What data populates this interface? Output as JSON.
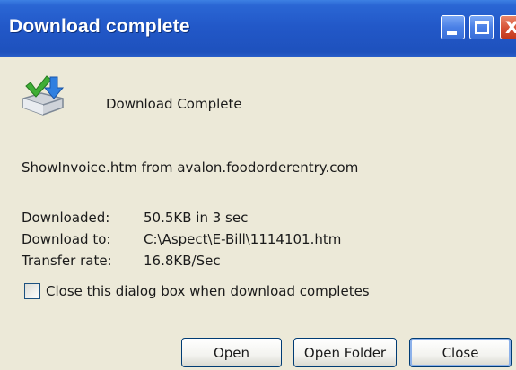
{
  "window": {
    "title": "Download complete",
    "controls": {
      "minimize": "minimize",
      "maximize": "maximize",
      "close": "close"
    },
    "close_glyph": "X"
  },
  "header": {
    "icon": "download-complete-icon",
    "text": "Download Complete"
  },
  "source": "ShowInvoice.htm from avalon.foodorderentry.com",
  "details": {
    "downloaded_label": "Downloaded:",
    "downloaded_value": "50.5KB in 3 sec",
    "download_to_label": "Download to:",
    "download_to_value": "C:\\Aspect\\E-Bill\\1114101.htm",
    "transfer_rate_label": "Transfer rate:",
    "transfer_rate_value": "16.8KB/Sec"
  },
  "options": {
    "close_when_complete_label": "Close this dialog box when download completes",
    "close_when_complete_checked": false
  },
  "buttons": {
    "open": "Open",
    "open_folder": "Open Folder",
    "close": "Close"
  },
  "colors": {
    "titlebar": "#2258c8",
    "dialog_background": "#ece9d8",
    "close_button": "#d65033",
    "button_border": "#003c74"
  }
}
